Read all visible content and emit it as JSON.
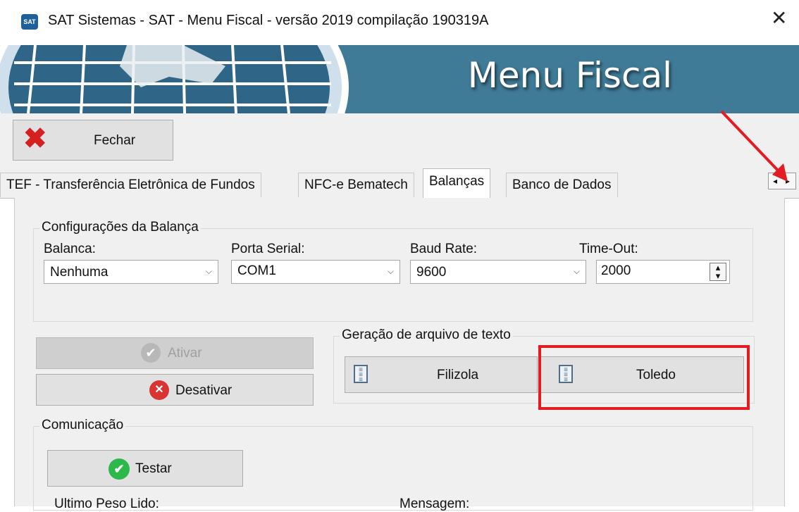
{
  "window": {
    "title": "SAT Sistemas - SAT - Menu Fiscal - versão 2019 compilação 190319A",
    "icon": "sat-app-icon",
    "close_glyph": "✕"
  },
  "banner": {
    "title": "Menu Fiscal"
  },
  "toolbar": {
    "fechar_label": "Fechar",
    "fechar_icon": "red-x-icon"
  },
  "tabs": [
    {
      "label": "TEF - Transferência Eletrônica de Fundos",
      "active": false
    },
    {
      "label": "NFC-e Bematech",
      "active": false
    },
    {
      "label": "Balanças",
      "active": true
    },
    {
      "label": "Banco de Dados",
      "active": false
    }
  ],
  "tab_scroll": {
    "left": "◂",
    "right": "▸"
  },
  "config": {
    "group_title": "Configurações da Balança",
    "balanca": {
      "label": "Balanca:",
      "value": "Nenhuma"
    },
    "porta": {
      "label": "Porta Serial:",
      "value": "COM1"
    },
    "baud": {
      "label": "Baud Rate:",
      "value": "9600"
    },
    "timeout": {
      "label": "Time-Out:",
      "value": "2000"
    }
  },
  "actions": {
    "ativar_label": "Ativar",
    "desativar_label": "Desativar"
  },
  "geracao": {
    "group_title": "Geração de arquivo de texto",
    "filizola_label": "Filizola",
    "toledo_label": "Toledo"
  },
  "comunicacao": {
    "group_title": "Comunicação",
    "testar_label": "Testar",
    "ultimo_peso_label": "Ultimo Peso Lido:",
    "mensagem_label": "Mensagem:"
  },
  "colors": {
    "banner": "#3f7a96",
    "annotation_red": "#e31b23",
    "fechar_icon": "#d42020",
    "testar_icon": "#2db84a",
    "desativar_icon": "#d93333"
  }
}
